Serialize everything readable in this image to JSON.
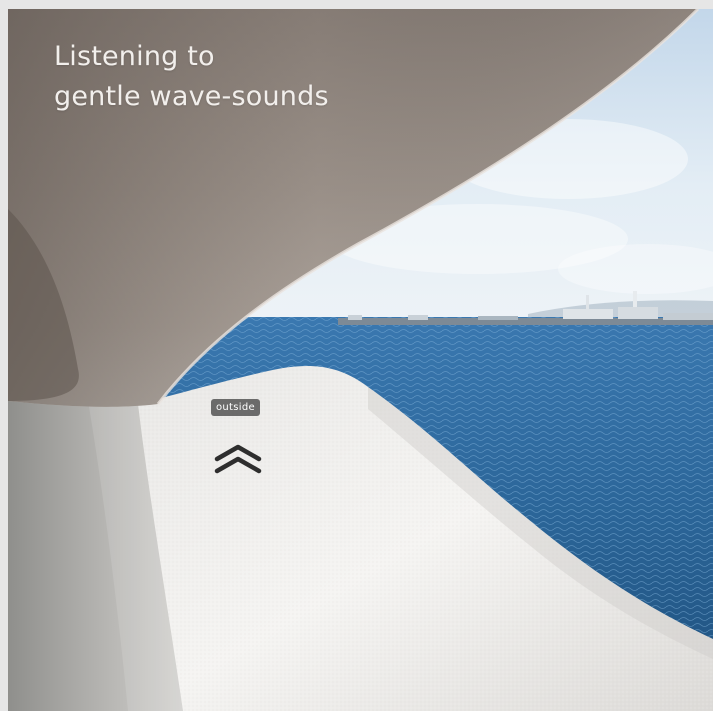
{
  "caption": {
    "line1": "Listening to",
    "line2": "gentle wave-sounds"
  },
  "hotspot": {
    "label": "outside",
    "icon": "double-chevron-up-icon"
  },
  "colors": {
    "sky": "#cfe0ee",
    "sea": "#2f6fa3",
    "shell_dark": "#7a6f67",
    "shell_light": "#f4f3f1",
    "caption": "#f2efec"
  }
}
